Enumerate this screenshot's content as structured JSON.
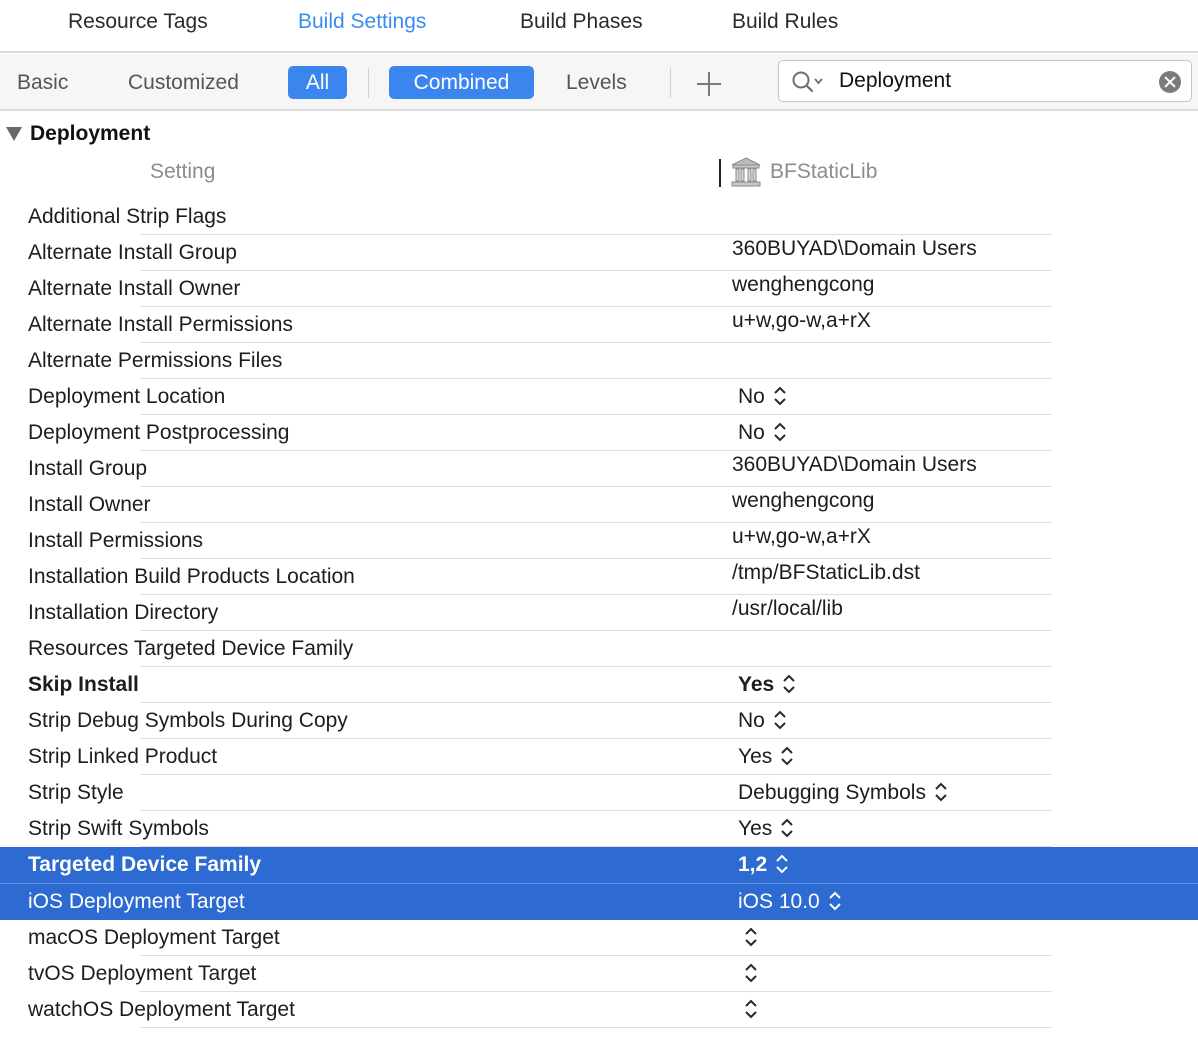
{
  "tabs": [
    {
      "label": "Resource Tags",
      "active": false
    },
    {
      "label": "Build Settings",
      "active": true
    },
    {
      "label": "Build Phases",
      "active": false
    },
    {
      "label": "Build Rules",
      "active": false
    }
  ],
  "filters": {
    "basic": "Basic",
    "customized": "Customized",
    "all": "All",
    "combined": "Combined",
    "levels": "Levels"
  },
  "search": {
    "value": "Deployment"
  },
  "section": {
    "title": "Deployment"
  },
  "columns": {
    "setting": "Setting",
    "target": "BFStaticLib"
  },
  "colors": {
    "accent": "#3b86ee",
    "selection": "#2d6ad2"
  },
  "rows": [
    {
      "name": "Additional Strip Flags",
      "value": "",
      "kind": "text"
    },
    {
      "name": "Alternate Install Group",
      "value": "360BUYAD\\Domain Users",
      "kind": "text"
    },
    {
      "name": "Alternate Install Owner",
      "value": "wenghengcong",
      "kind": "text"
    },
    {
      "name": "Alternate Install Permissions",
      "value": "u+w,go-w,a+rX",
      "kind": "text"
    },
    {
      "name": "Alternate Permissions Files",
      "value": "",
      "kind": "text"
    },
    {
      "name": "Deployment Location",
      "value": "No",
      "kind": "popup"
    },
    {
      "name": "Deployment Postprocessing",
      "value": "No",
      "kind": "popup"
    },
    {
      "name": "Install Group",
      "value": "360BUYAD\\Domain Users",
      "kind": "text"
    },
    {
      "name": "Install Owner",
      "value": "wenghengcong",
      "kind": "text"
    },
    {
      "name": "Install Permissions",
      "value": "u+w,go-w,a+rX",
      "kind": "text"
    },
    {
      "name": "Installation Build Products Location",
      "value": "/tmp/BFStaticLib.dst",
      "kind": "text"
    },
    {
      "name": "Installation Directory",
      "value": "/usr/local/lib",
      "kind": "text"
    },
    {
      "name": "Resources Targeted Device Family",
      "value": "",
      "kind": "text"
    },
    {
      "name": "Skip Install",
      "value": "Yes",
      "kind": "popup",
      "bold": true
    },
    {
      "name": "Strip Debug Symbols During Copy",
      "value": "No",
      "kind": "popup"
    },
    {
      "name": "Strip Linked Product",
      "value": "Yes",
      "kind": "popup"
    },
    {
      "name": "Strip Style",
      "value": "Debugging Symbols",
      "kind": "popup"
    },
    {
      "name": "Strip Swift Symbols",
      "value": "Yes",
      "kind": "popup"
    },
    {
      "name": "Targeted Device Family",
      "value": "1,2",
      "kind": "popup",
      "bold": true,
      "selected": true
    },
    {
      "name": "iOS Deployment Target",
      "value": "iOS 10.0",
      "kind": "popup",
      "selected": true
    },
    {
      "name": "macOS Deployment Target",
      "value": "",
      "kind": "popup"
    },
    {
      "name": "tvOS Deployment Target",
      "value": "",
      "kind": "popup"
    },
    {
      "name": "watchOS Deployment Target",
      "value": "",
      "kind": "popup"
    }
  ]
}
